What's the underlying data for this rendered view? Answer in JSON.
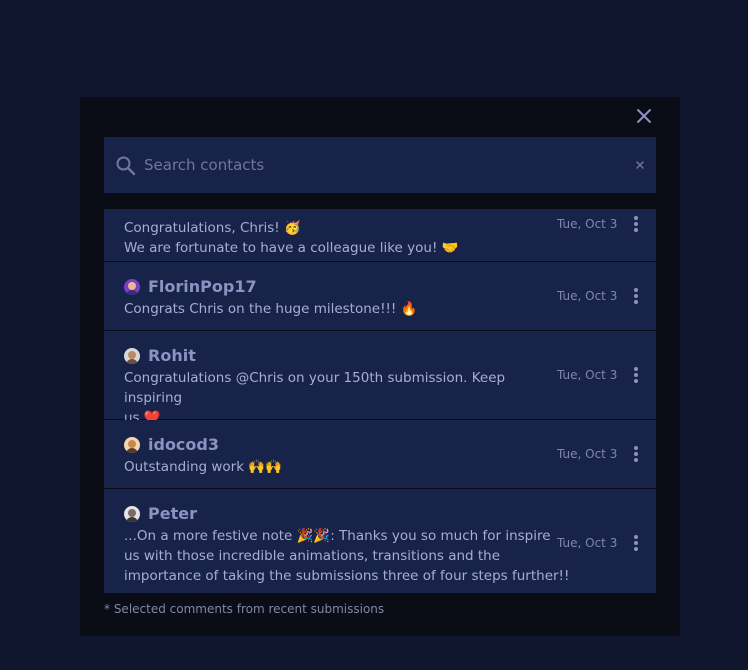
{
  "search": {
    "placeholder": "Search contacts",
    "value": ""
  },
  "comments": [
    {
      "name": "",
      "lines": [
        "Congratulations, Chris! 🥳",
        "We are fortunate to have a colleague like you! 🤝"
      ],
      "date": "Tue, Oct 3"
    },
    {
      "name": "FlorinPop17",
      "lines": [
        "Congrats Chris on the huge milestone!!! 🔥"
      ],
      "date": "Tue, Oct 3"
    },
    {
      "name": "Rohit",
      "lines": [
        "Congratulations @Chris on your 150th submission. Keep inspiring",
        "us ❤️."
      ],
      "date": "Tue, Oct 3"
    },
    {
      "name": "idocod3",
      "lines": [
        "Outstanding work 🙌🙌"
      ],
      "date": "Tue, Oct 3"
    },
    {
      "name": "Peter",
      "lines": [
        "...On a more festive note 🎉🎉: Thanks you so much for inspire",
        "us with those incredible animations, transitions and the",
        "importance of taking the submissions three of four steps further!!"
      ],
      "date": "Tue, Oct 3"
    }
  ],
  "footnote": "* Selected comments from recent submissions",
  "colors": {
    "page_bg": "#11162f",
    "modal_bg": "#0a0c16",
    "row_bg": "#172349",
    "search_bg": "#18234a"
  },
  "icons": {
    "close": "close-icon",
    "search": "search-icon",
    "clear": "clear-icon",
    "more": "more-vertical-icon"
  }
}
